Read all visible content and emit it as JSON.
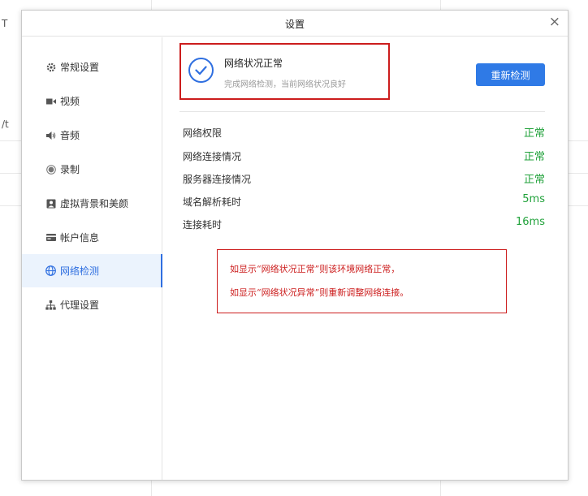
{
  "dialog": {
    "title": "设置",
    "close_symbol": "×"
  },
  "sidebar": {
    "items": [
      {
        "label": "常规设置",
        "icon": "gear-icon"
      },
      {
        "label": "视频",
        "icon": "video-icon"
      },
      {
        "label": "音频",
        "icon": "speaker-icon"
      },
      {
        "label": "录制",
        "icon": "record-icon"
      },
      {
        "label": "虚拟背景和美颜",
        "icon": "portrait-icon"
      },
      {
        "label": "帐户信息",
        "icon": "card-icon"
      },
      {
        "label": "网络检测",
        "icon": "globe-icon",
        "active": true
      },
      {
        "label": "代理设置",
        "icon": "network-tree-icon"
      }
    ]
  },
  "status": {
    "title": "网络状况正常",
    "subtitle": "完成网络检测，当前网络状况良好",
    "button_label": "重新检测"
  },
  "checks": [
    {
      "label": "网络权限",
      "value": "正常"
    },
    {
      "label": "网络连接情况",
      "value": "正常"
    },
    {
      "label": "服务器连接情况",
      "value": "正常"
    },
    {
      "label": "域名解析耗时",
      "value": "5ms"
    },
    {
      "label": "连接耗时",
      "value": "16ms"
    }
  ],
  "annotation": {
    "line1": "如显示“网络状况正常”则该环境网络正常，",
    "line2": "如显示“网络状况异常”则重新调整网络连接。"
  },
  "colors": {
    "accent": "#2f6fe0",
    "ok": "#21a23b",
    "annotation_red": "#cc1d1d"
  }
}
